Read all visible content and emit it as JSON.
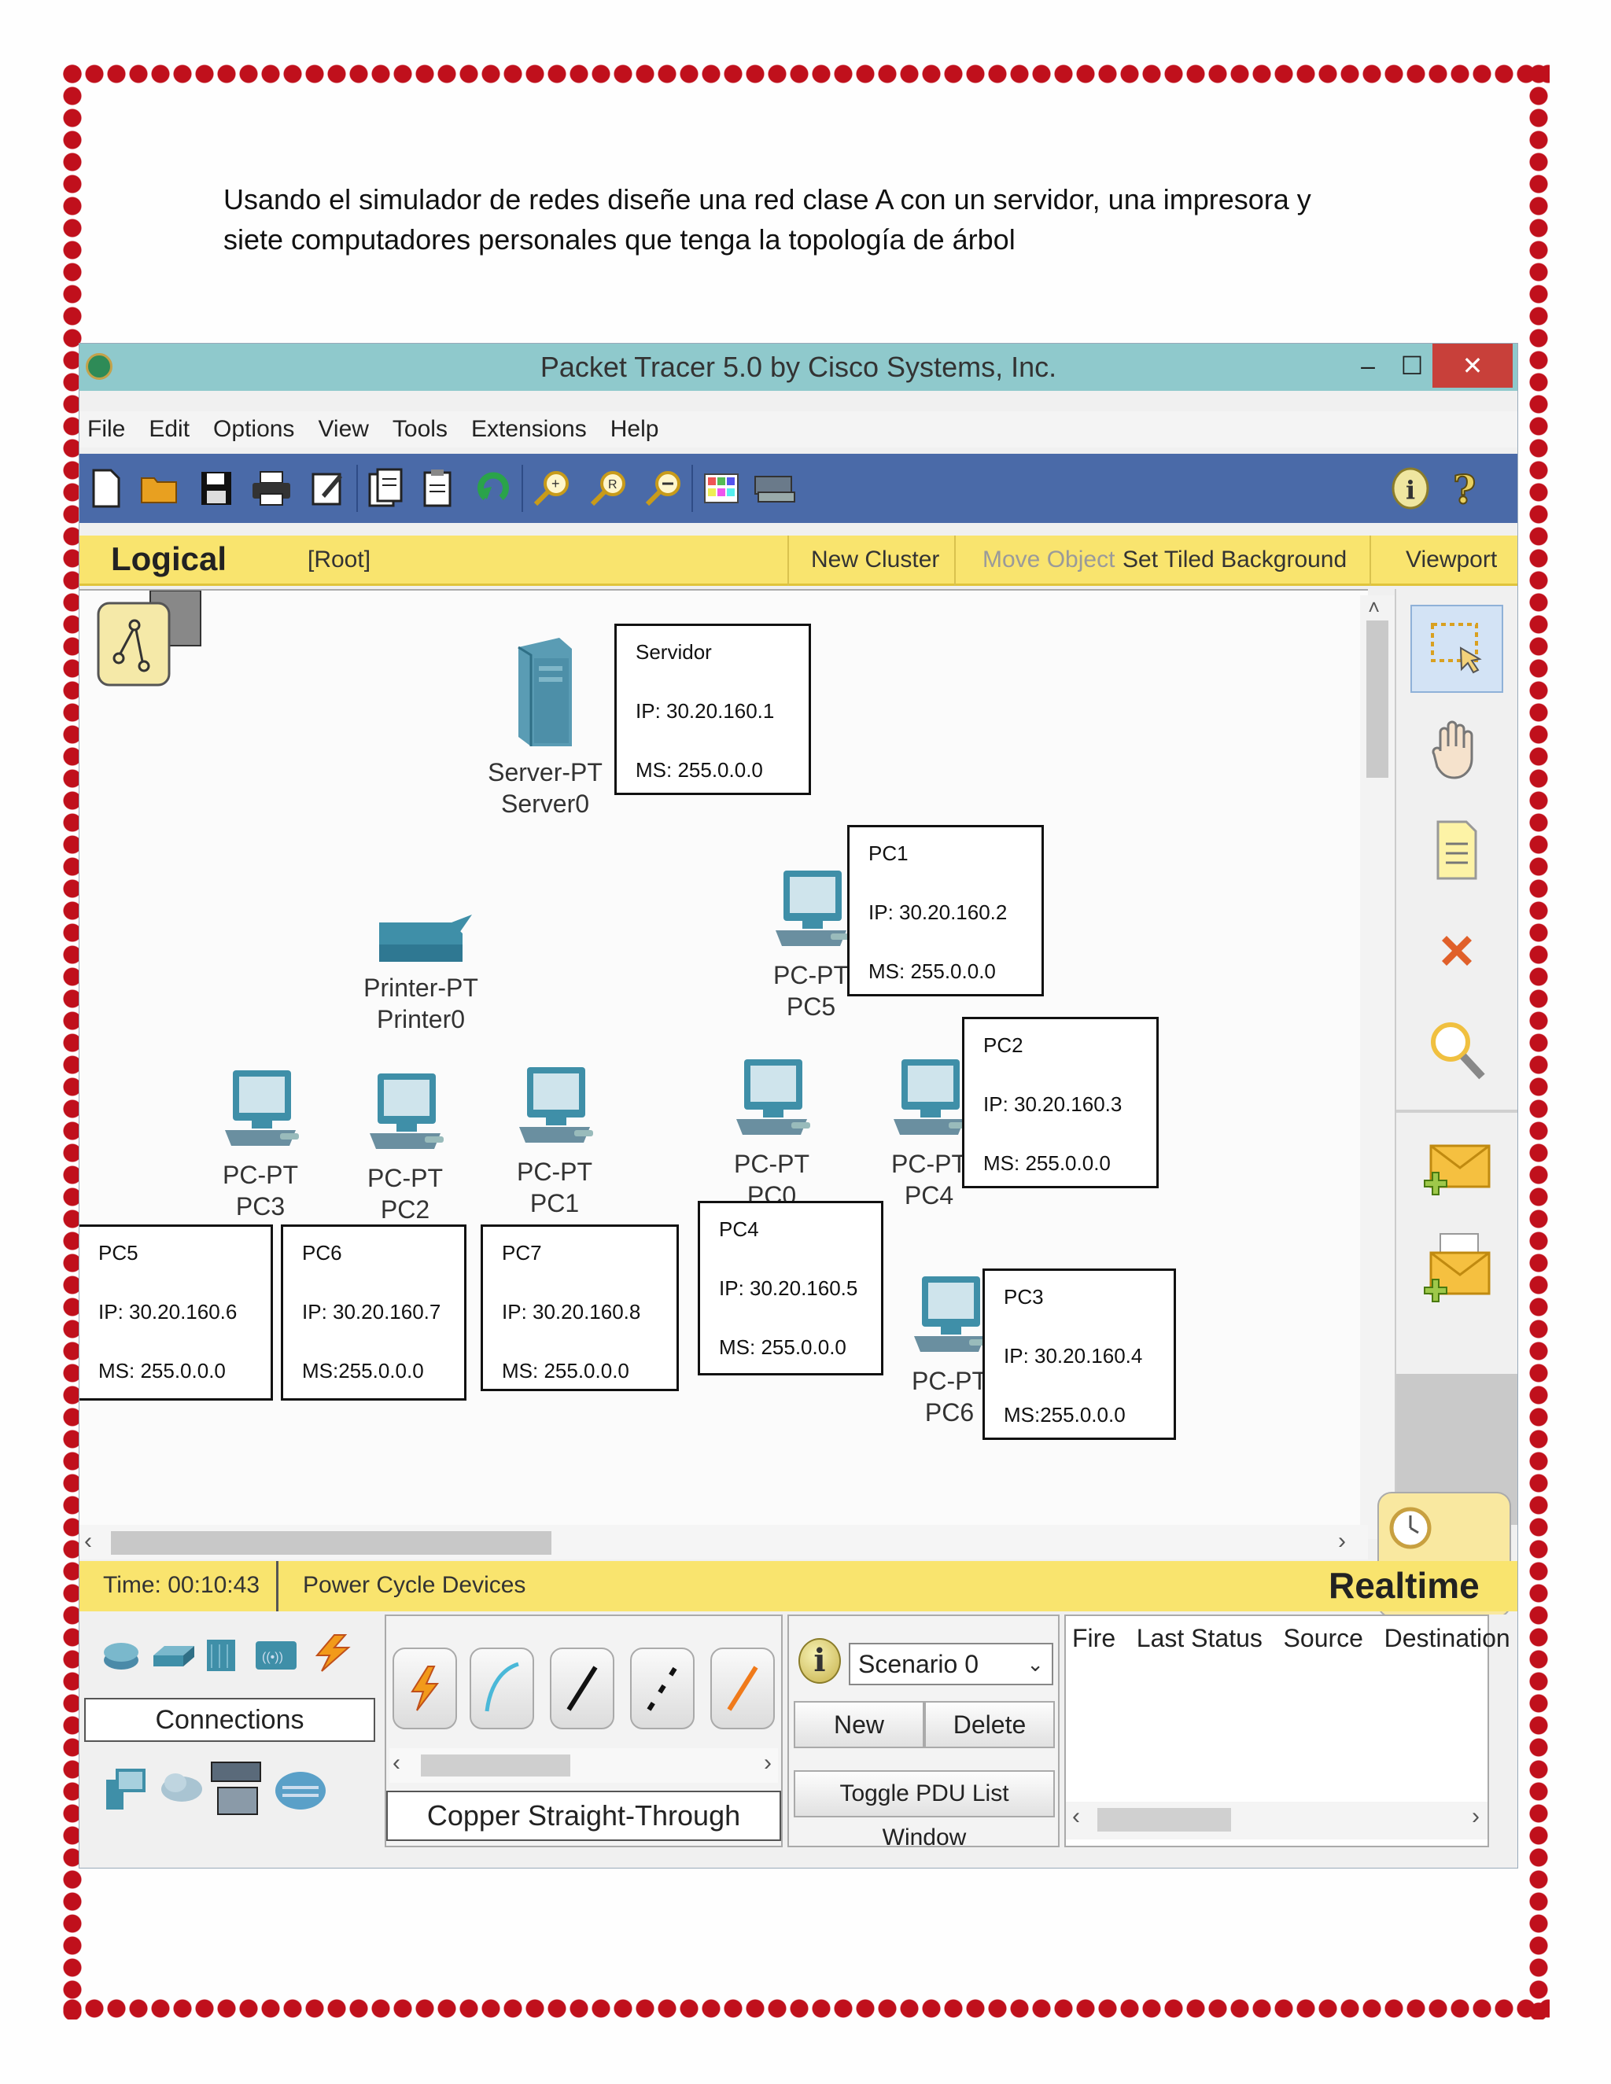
{
  "document": {
    "instruction_line1": "Usando el simulador de redes diseñe una red clase A con un servidor, una impresora y",
    "instruction_line2": "siete computadores personales que tenga la topología de árbol"
  },
  "window": {
    "title": "Packet Tracer 5.0 by Cisco Systems, Inc.",
    "minimize": "–",
    "maximize": "☐",
    "close": "✕"
  },
  "menu": [
    "File",
    "Edit",
    "Options",
    "View",
    "Tools",
    "Extensions",
    "Help"
  ],
  "toolbar_icons": [
    "new-file-icon",
    "open-folder-icon",
    "save-icon",
    "print-icon",
    "activity-wizard-icon",
    "copy-icon",
    "paste-icon",
    "undo-icon",
    "zoom-in-icon",
    "zoom-reset-icon",
    "zoom-out-icon",
    "palette-icon",
    "custom-device-icon",
    "info-icon",
    "help-icon"
  ],
  "logical_bar": {
    "title": "Logical",
    "root": "[Root]",
    "new_cluster": "New Cluster",
    "move_object": "Move Object",
    "set_tiled_background": "Set Tiled Background",
    "viewport": "Viewport"
  },
  "devices": [
    {
      "type": "Server-PT",
      "name": "Server0"
    },
    {
      "type": "Printer-PT",
      "name": "Printer0"
    },
    {
      "type": "PC-PT",
      "name": "PC5"
    },
    {
      "type": "PC-PT",
      "name": "PC3"
    },
    {
      "type": "PC-PT",
      "name": "PC2"
    },
    {
      "type": "PC-PT",
      "name": "PC1"
    },
    {
      "type": "PC-PT",
      "name": "PC0"
    },
    {
      "type": "PC-PT",
      "name": "PC4"
    },
    {
      "type": "PC-PT",
      "name": "PC6"
    }
  ],
  "labels": [
    {
      "title": "Servidor",
      "ip": "IP: 30.20.160.1",
      "ms": "MS: 255.0.0.0"
    },
    {
      "title": "PC1",
      "ip": "IP: 30.20.160.2",
      "ms": "MS: 255.0.0.0"
    },
    {
      "title": "PC2",
      "ip": "IP: 30.20.160.3",
      "ms": "MS: 255.0.0.0"
    },
    {
      "title": "PC5",
      "ip": "IP: 30.20.160.6",
      "ms": "MS: 255.0.0.0"
    },
    {
      "title": "PC6",
      "ip": "IP: 30.20.160.7",
      "ms": "MS:255.0.0.0"
    },
    {
      "title": "PC7",
      "ip": "IP: 30.20.160.8",
      "ms": "MS: 255.0.0.0"
    },
    {
      "title": "PC4",
      "ip": "IP: 30.20.160.5",
      "ms": "MS: 255.0.0.0"
    },
    {
      "title": "PC3",
      "ip": "IP: 30.20.160.4",
      "ms": "MS:255.0.0.0"
    }
  ],
  "status_bar": {
    "time": "Time: 00:10:43",
    "power_cycle": "Power Cycle Devices",
    "mode": "Realtime"
  },
  "bottom_panel": {
    "connections_label": "Connections",
    "cable_label": "Copper Straight-Through",
    "scenario": "Scenario 0",
    "new_button": "New",
    "delete_button": "Delete",
    "toggle_pdu": "Toggle PDU List Window",
    "pdu_columns": [
      "Fire",
      "Last Status",
      "Source",
      "Destination"
    ]
  },
  "colors": {
    "border_dots": "#c0101c",
    "titlebar": "#8fc9cc",
    "toolbar": "#4a6aa8",
    "logical_bar": "#f9e46e",
    "device_teal": "#3f8fa8",
    "close_button": "#c8403a"
  }
}
